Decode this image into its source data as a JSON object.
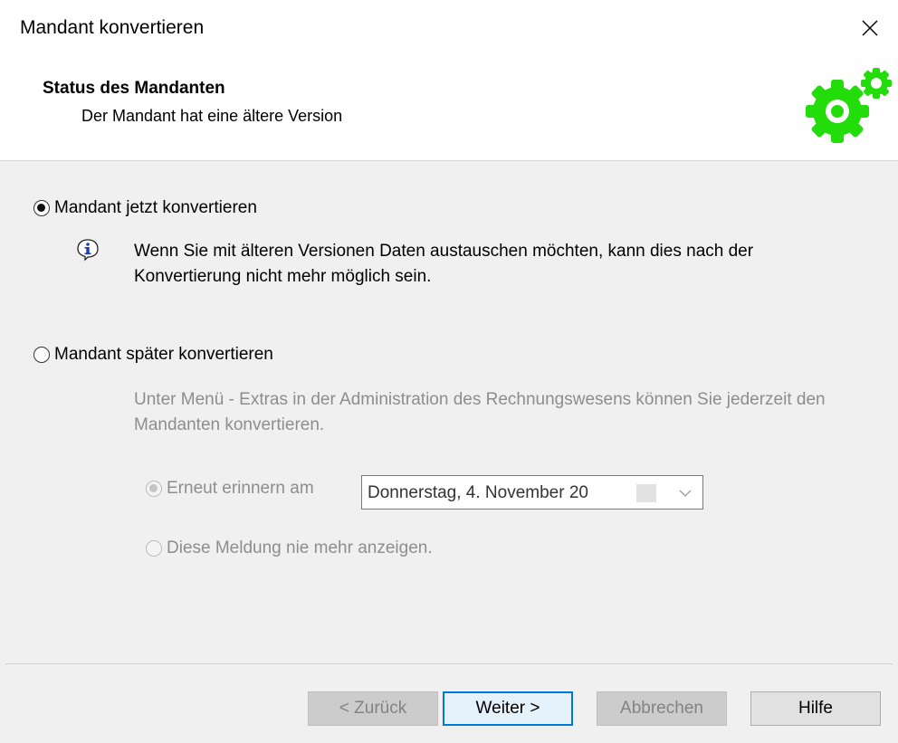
{
  "window": {
    "title": "Mandant konvertieren"
  },
  "header": {
    "title": "Status des Mandanten",
    "subtitle": "Der Mandant hat eine ältere Version"
  },
  "options": {
    "convert_now": {
      "label": "Mandant jetzt konvertieren",
      "checked": true
    },
    "info_text": "Wenn Sie mit älteren Versionen Daten austauschen möchten, kann dies nach der Konvertierung nicht mehr möglich sein.",
    "convert_later": {
      "label": "Mandant später konvertieren",
      "checked": false
    },
    "later_text": "Unter Menü - Extras in der Administration des Rechnungswesens können Sie jederzeit den Mandanten konvertieren.",
    "remind": {
      "label": "Erneut erinnern am",
      "checked": true,
      "enabled": false
    },
    "date_value": "Donnerstag,  4. November 20",
    "never_show": {
      "label": "Diese Meldung nie mehr anzeigen.",
      "checked": false,
      "enabled": false
    }
  },
  "buttons": {
    "back": "< Zurück",
    "next": "Weiter >",
    "cancel": "Abbrechen",
    "help": "Hilfe"
  },
  "colors": {
    "accent": "#0078d7",
    "gear": "#22dd0a",
    "disabled_text": "#8d8d8d"
  }
}
